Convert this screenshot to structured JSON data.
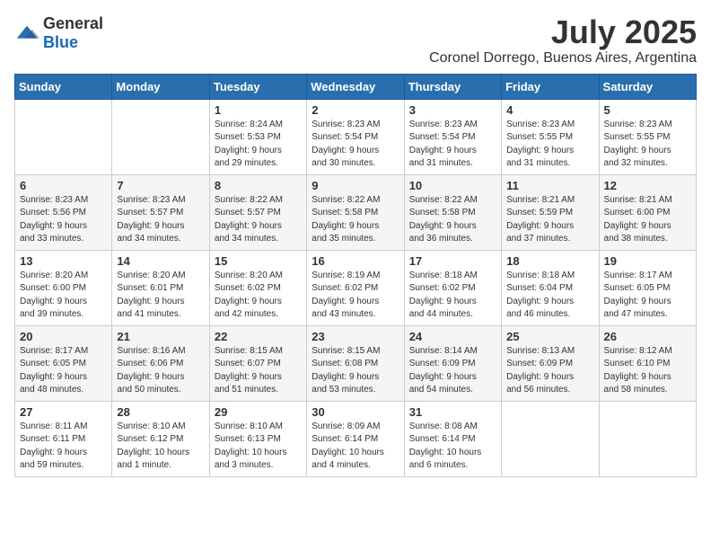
{
  "logo": {
    "general": "General",
    "blue": "Blue"
  },
  "title": "July 2025",
  "location": "Coronel Dorrego, Buenos Aires, Argentina",
  "days_of_week": [
    "Sunday",
    "Monday",
    "Tuesday",
    "Wednesday",
    "Thursday",
    "Friday",
    "Saturday"
  ],
  "weeks": [
    [
      {
        "day": "",
        "info": ""
      },
      {
        "day": "",
        "info": ""
      },
      {
        "day": "1",
        "info": "Sunrise: 8:24 AM\nSunset: 5:53 PM\nDaylight: 9 hours\nand 29 minutes."
      },
      {
        "day": "2",
        "info": "Sunrise: 8:23 AM\nSunset: 5:54 PM\nDaylight: 9 hours\nand 30 minutes."
      },
      {
        "day": "3",
        "info": "Sunrise: 8:23 AM\nSunset: 5:54 PM\nDaylight: 9 hours\nand 31 minutes."
      },
      {
        "day": "4",
        "info": "Sunrise: 8:23 AM\nSunset: 5:55 PM\nDaylight: 9 hours\nand 31 minutes."
      },
      {
        "day": "5",
        "info": "Sunrise: 8:23 AM\nSunset: 5:55 PM\nDaylight: 9 hours\nand 32 minutes."
      }
    ],
    [
      {
        "day": "6",
        "info": "Sunrise: 8:23 AM\nSunset: 5:56 PM\nDaylight: 9 hours\nand 33 minutes."
      },
      {
        "day": "7",
        "info": "Sunrise: 8:23 AM\nSunset: 5:57 PM\nDaylight: 9 hours\nand 34 minutes."
      },
      {
        "day": "8",
        "info": "Sunrise: 8:22 AM\nSunset: 5:57 PM\nDaylight: 9 hours\nand 34 minutes."
      },
      {
        "day": "9",
        "info": "Sunrise: 8:22 AM\nSunset: 5:58 PM\nDaylight: 9 hours\nand 35 minutes."
      },
      {
        "day": "10",
        "info": "Sunrise: 8:22 AM\nSunset: 5:58 PM\nDaylight: 9 hours\nand 36 minutes."
      },
      {
        "day": "11",
        "info": "Sunrise: 8:21 AM\nSunset: 5:59 PM\nDaylight: 9 hours\nand 37 minutes."
      },
      {
        "day": "12",
        "info": "Sunrise: 8:21 AM\nSunset: 6:00 PM\nDaylight: 9 hours\nand 38 minutes."
      }
    ],
    [
      {
        "day": "13",
        "info": "Sunrise: 8:20 AM\nSunset: 6:00 PM\nDaylight: 9 hours\nand 39 minutes."
      },
      {
        "day": "14",
        "info": "Sunrise: 8:20 AM\nSunset: 6:01 PM\nDaylight: 9 hours\nand 41 minutes."
      },
      {
        "day": "15",
        "info": "Sunrise: 8:20 AM\nSunset: 6:02 PM\nDaylight: 9 hours\nand 42 minutes."
      },
      {
        "day": "16",
        "info": "Sunrise: 8:19 AM\nSunset: 6:02 PM\nDaylight: 9 hours\nand 43 minutes."
      },
      {
        "day": "17",
        "info": "Sunrise: 8:18 AM\nSunset: 6:02 PM\nDaylight: 9 hours\nand 44 minutes."
      },
      {
        "day": "18",
        "info": "Sunrise: 8:18 AM\nSunset: 6:04 PM\nDaylight: 9 hours\nand 46 minutes."
      },
      {
        "day": "19",
        "info": "Sunrise: 8:17 AM\nSunset: 6:05 PM\nDaylight: 9 hours\nand 47 minutes."
      }
    ],
    [
      {
        "day": "20",
        "info": "Sunrise: 8:17 AM\nSunset: 6:05 PM\nDaylight: 9 hours\nand 48 minutes."
      },
      {
        "day": "21",
        "info": "Sunrise: 8:16 AM\nSunset: 6:06 PM\nDaylight: 9 hours\nand 50 minutes."
      },
      {
        "day": "22",
        "info": "Sunrise: 8:15 AM\nSunset: 6:07 PM\nDaylight: 9 hours\nand 51 minutes."
      },
      {
        "day": "23",
        "info": "Sunrise: 8:15 AM\nSunset: 6:08 PM\nDaylight: 9 hours\nand 53 minutes."
      },
      {
        "day": "24",
        "info": "Sunrise: 8:14 AM\nSunset: 6:09 PM\nDaylight: 9 hours\nand 54 minutes."
      },
      {
        "day": "25",
        "info": "Sunrise: 8:13 AM\nSunset: 6:09 PM\nDaylight: 9 hours\nand 56 minutes."
      },
      {
        "day": "26",
        "info": "Sunrise: 8:12 AM\nSunset: 6:10 PM\nDaylight: 9 hours\nand 58 minutes."
      }
    ],
    [
      {
        "day": "27",
        "info": "Sunrise: 8:11 AM\nSunset: 6:11 PM\nDaylight: 9 hours\nand 59 minutes."
      },
      {
        "day": "28",
        "info": "Sunrise: 8:10 AM\nSunset: 6:12 PM\nDaylight: 10 hours\nand 1 minute."
      },
      {
        "day": "29",
        "info": "Sunrise: 8:10 AM\nSunset: 6:13 PM\nDaylight: 10 hours\nand 3 minutes."
      },
      {
        "day": "30",
        "info": "Sunrise: 8:09 AM\nSunset: 6:14 PM\nDaylight: 10 hours\nand 4 minutes."
      },
      {
        "day": "31",
        "info": "Sunrise: 8:08 AM\nSunset: 6:14 PM\nDaylight: 10 hours\nand 6 minutes."
      },
      {
        "day": "",
        "info": ""
      },
      {
        "day": "",
        "info": ""
      }
    ]
  ]
}
